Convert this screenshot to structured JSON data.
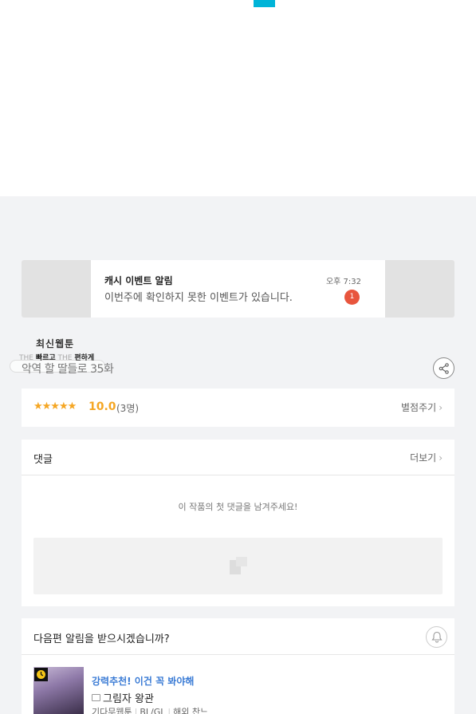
{
  "notification": {
    "title": "캐시 이벤트 알림",
    "time": "오후 7:32",
    "message": "이번주에 확인하지 못한 이벤트가 있습니다.",
    "badge": "1"
  },
  "logo": {
    "title": "최신웹툰",
    "the1": "THE",
    "word1": "빠르고",
    "the2": "THE",
    "word2": "편하게"
  },
  "episode": {
    "title": "악역 할 딸들로 35화"
  },
  "rating": {
    "stars": "★★★★★",
    "score": "10.0",
    "count": "(3명)",
    "rate_label": "별점주기"
  },
  "comments": {
    "title": "댓글",
    "more_label": "더보기",
    "empty_message": "이 작품의 첫 댓글을 남겨주세요!"
  },
  "next_episode": {
    "prompt": "다음편 알림을 받으시겠습니까?"
  },
  "recommendation": {
    "headline": "강력추천! 이건 꼭 봐야해",
    "name": "그림자 왕관",
    "genre": "기다무웹툰",
    "category": "BL/GL",
    "origin": "해외 찬느"
  },
  "colors": {
    "accent": "#00b4d8",
    "star": "#f5a623",
    "badge": "#e8553d",
    "link": "#3a7bd5"
  }
}
